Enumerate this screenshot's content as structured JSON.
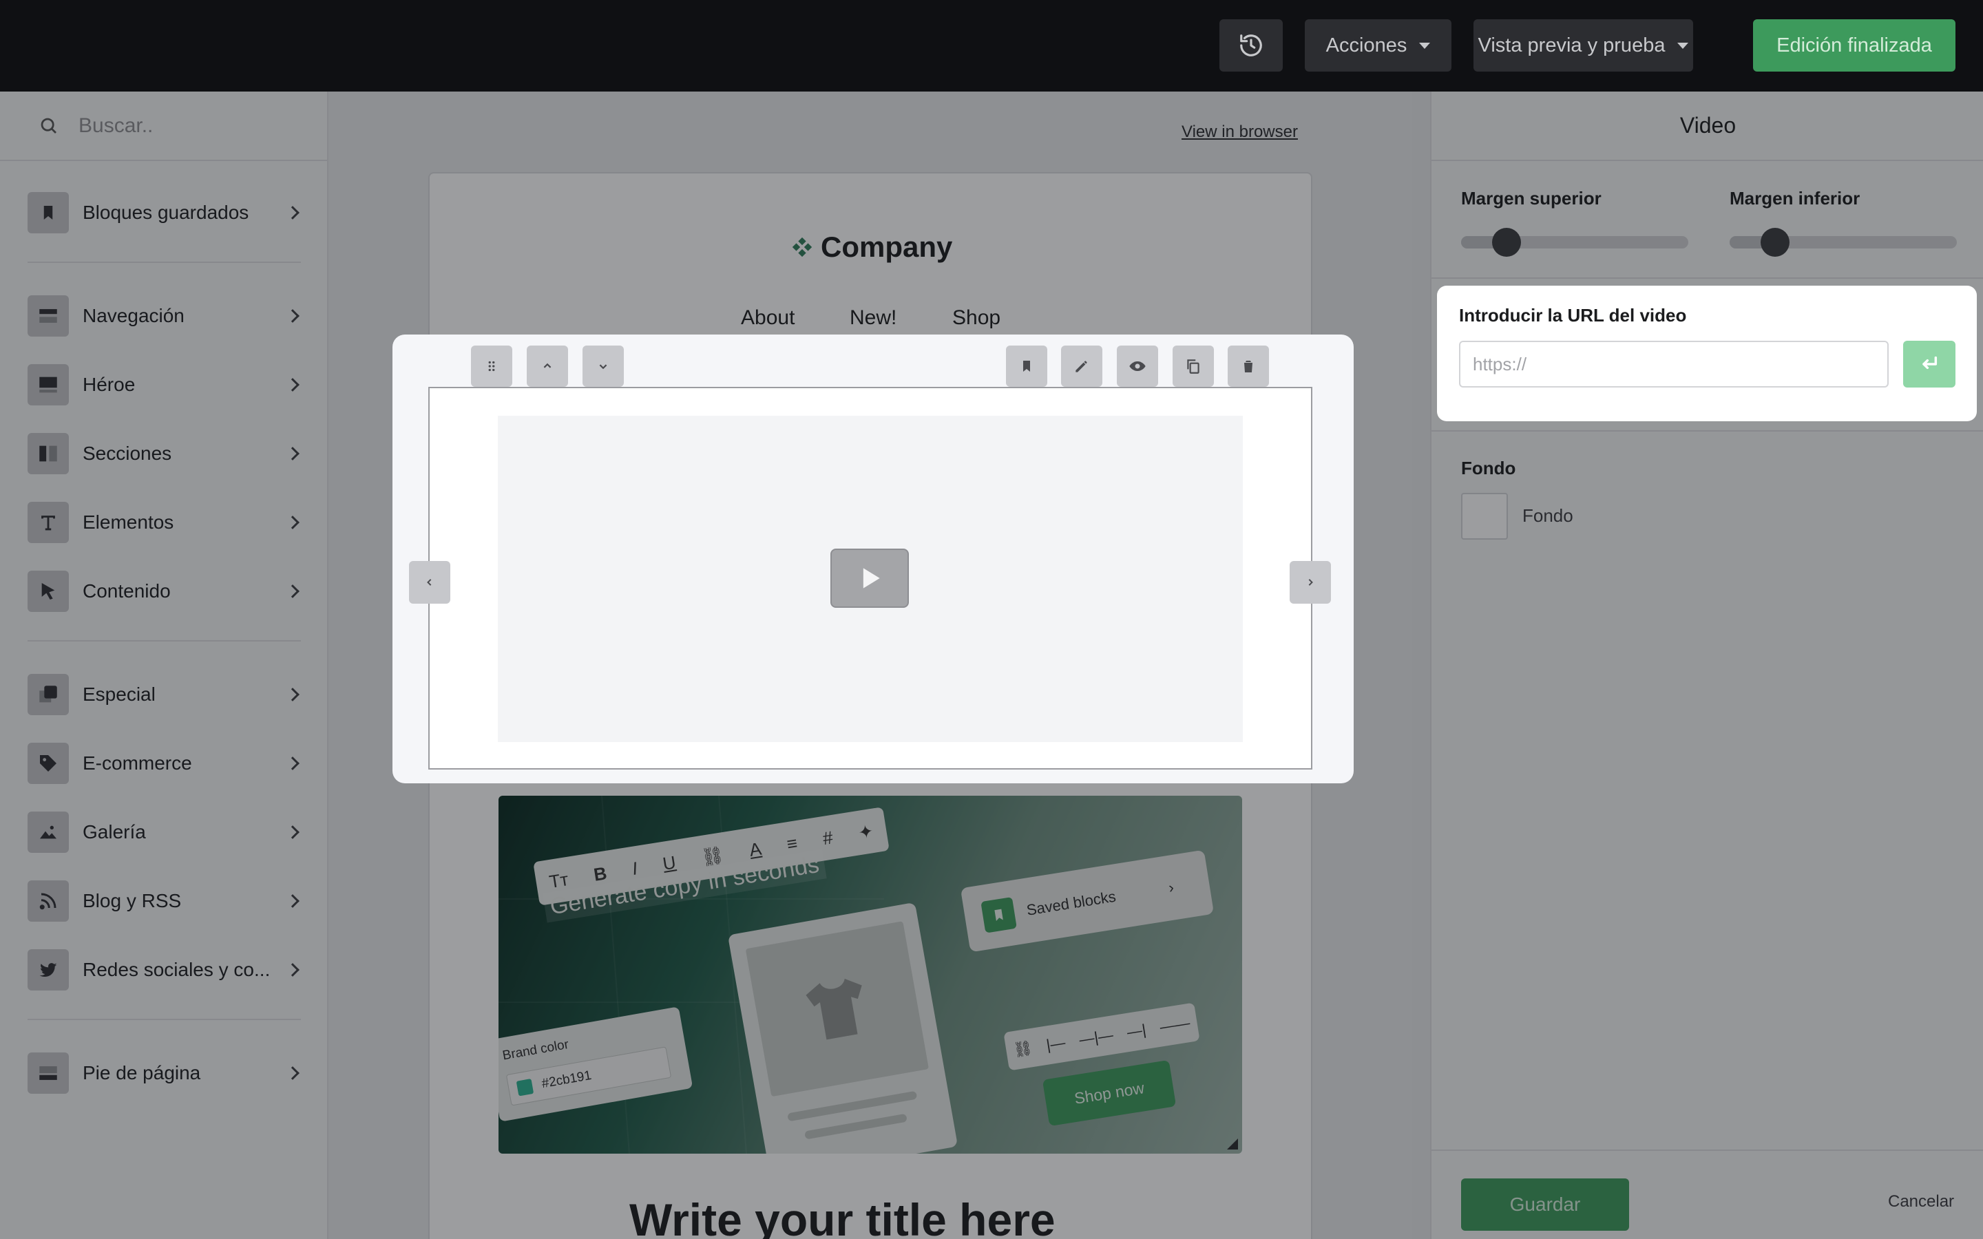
{
  "topbar": {
    "acciones_label": "Acciones",
    "preview_label": "Vista previa y prueba",
    "done_label": "Edición finalizada"
  },
  "sidebar": {
    "search_placeholder": "Buscar..",
    "items": [
      {
        "label": "Bloques guardados",
        "icon": "bookmark-icon"
      },
      {
        "label": "Navegación",
        "icon": "navigation-icon"
      },
      {
        "label": "Héroe",
        "icon": "hero-icon"
      },
      {
        "label": "Secciones",
        "icon": "columns-icon"
      },
      {
        "label": "Elementos",
        "icon": "text-icon"
      },
      {
        "label": "Contenido",
        "icon": "cursor-icon"
      },
      {
        "label": "Especial",
        "icon": "layers-icon"
      },
      {
        "label": "E-commerce",
        "icon": "tag-icon"
      },
      {
        "label": "Galería",
        "icon": "image-icon"
      },
      {
        "label": "Blog y RSS",
        "icon": "rss-icon"
      },
      {
        "label": "Redes sociales y co...",
        "icon": "twitter-icon"
      },
      {
        "label": "Pie de página",
        "icon": "footer-icon"
      }
    ]
  },
  "canvas": {
    "view_in_browser": "View in browser",
    "company": "Company",
    "nav": [
      "About",
      "New!",
      "Shop"
    ],
    "hero": {
      "headline": "Generate copy in seconds",
      "saved_blocks": "Saved blocks",
      "brand_color_label": "Brand color",
      "brand_color_value": "#2cb191",
      "shop_now": "Shop now"
    },
    "title": "Write your title here"
  },
  "panel": {
    "title": "Video",
    "margin_top_label": "Margen superior",
    "margin_bottom_label": "Margen inferior",
    "margin_top_value": 0.2,
    "margin_bottom_value": 0.2,
    "url_label": "Introducir la URL del video",
    "url_placeholder": "https://",
    "fondo_heading": "Fondo",
    "fondo_label": "Fondo",
    "save_label": "Guardar",
    "cancel_label": "Cancelar"
  },
  "colors": {
    "accent": "#3d9a5c",
    "brand_swatch": "#2cb191"
  }
}
